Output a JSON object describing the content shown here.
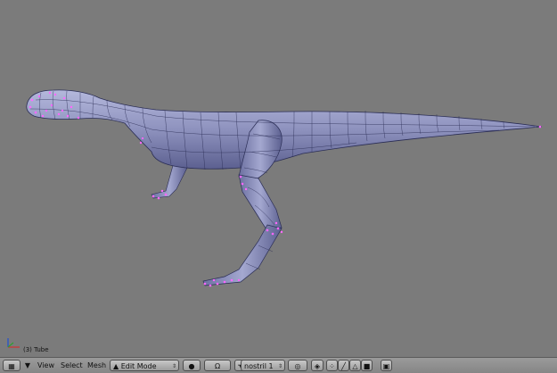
{
  "viewport": {
    "object_label": "(3) Tube",
    "background": "#7b7b7b",
    "mesh_color": "#9a9ec8",
    "selection_color": "#ff66ff"
  },
  "header": {
    "menus": [
      "View",
      "Select",
      "Mesh"
    ],
    "mode_label": "Edit Mode",
    "layer_label": "nostril 1",
    "icons": {
      "editor_type": "grid-icon",
      "collapse": "triangle-down-icon",
      "mode": "triangle-mode-icon",
      "viewport_shading": "solid-sphere-icon",
      "pivot": "pivot-icon",
      "manipulator": "manipulator-icon",
      "proportional": "proportional-icon",
      "vertex_select": "vertex-select-icon",
      "edge_select": "edge-select-icon",
      "face_select": "face-select-icon",
      "occlude": "occlude-icon",
      "render": "render-icon"
    }
  }
}
